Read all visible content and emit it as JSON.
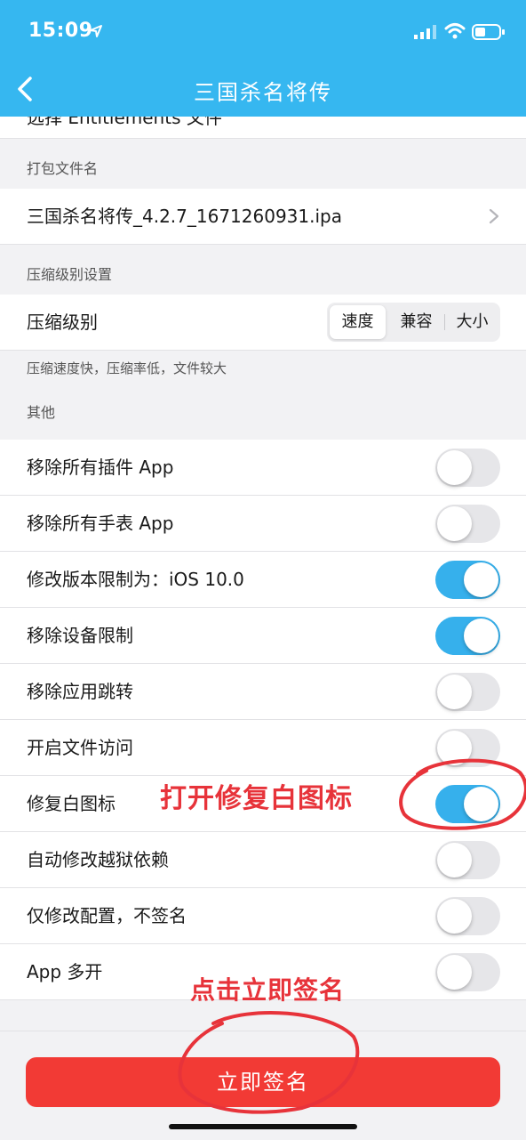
{
  "status_bar": {
    "time": "15:09"
  },
  "nav": {
    "title": "三国杀名将传"
  },
  "cut_row_label": "选择 Entitlements 文件",
  "sections": {
    "package_name_header": "打包文件名",
    "package_file": "三国杀名将传_4.2.7_1671260931.ipa",
    "compression_header": "压缩级别设置",
    "compression_label": "压缩级别",
    "compression_options": [
      "速度",
      "兼容",
      "大小"
    ],
    "compression_selected": "速度",
    "compression_hint": "压缩速度快，压缩率低，文件较大",
    "other_header": "其他"
  },
  "toggles": [
    {
      "label": "移除所有插件 App",
      "on": false
    },
    {
      "label": "移除所有手表 App",
      "on": false
    },
    {
      "label": "修改版本限制为：iOS 10.0",
      "on": true
    },
    {
      "label": "移除设备限制",
      "on": true
    },
    {
      "label": "移除应用跳转",
      "on": false
    },
    {
      "label": "开启文件访问",
      "on": false
    },
    {
      "label": "修复白图标",
      "on": true
    },
    {
      "label": "自动修改越狱依赖",
      "on": false
    },
    {
      "label": "仅修改配置，不签名",
      "on": false
    },
    {
      "label": "App 多开",
      "on": false
    }
  ],
  "sign_button": "立即签名",
  "annotations": {
    "fix_icon": "打开修复白图标",
    "click_sign": "点击立即签名"
  },
  "colors": {
    "header": "#36b7f0",
    "toggle_on": "#36b0ec",
    "sign_button": "#f23a35",
    "annotation": "#e7333a"
  }
}
